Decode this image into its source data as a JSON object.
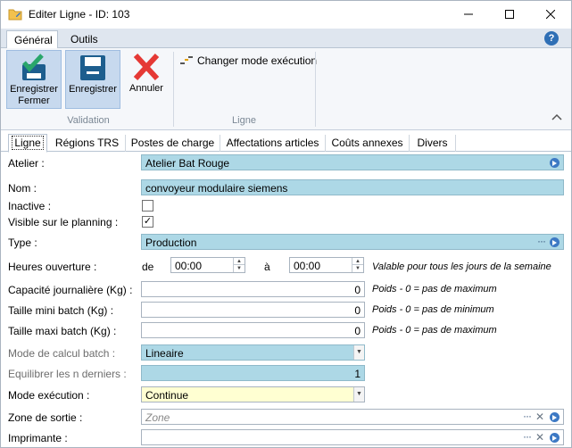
{
  "window": {
    "title": "Editer Ligne - ID: 103"
  },
  "ribbon_tabs": [
    "Général",
    "Outils"
  ],
  "ribbon": {
    "save_close": "Enregistrer\nFermer",
    "save": "Enregistrer",
    "cancel": "Annuler",
    "group_validation": "Validation",
    "change_mode": "Changer mode exécution",
    "group_ligne": "Ligne"
  },
  "tabs": [
    "Ligne",
    "Régions TRS",
    "Postes de charge",
    "Affectations articles",
    "Coûts annexes",
    "Divers"
  ],
  "form": {
    "atelier": {
      "label": "Atelier :",
      "value": "Atelier Bat Rouge"
    },
    "nom": {
      "label": "Nom :",
      "value": "convoyeur modulaire siemens"
    },
    "inactive": {
      "label": "Inactive :",
      "checked": false
    },
    "visible": {
      "label": "Visible sur le planning :",
      "checked": true,
      "mark": "✓"
    },
    "type": {
      "label": "Type :",
      "value": "Production"
    },
    "heures": {
      "label": "Heures ouverture :",
      "de_label": "de",
      "de_value": "00:00",
      "a_label": "à",
      "a_value": "00:00",
      "note": "Valable pour tous les jours de la semaine"
    },
    "capacite": {
      "label": "Capacité journalière (Kg) :",
      "value": "0",
      "note": "Poids - 0 = pas de maximum"
    },
    "taille_mini": {
      "label": "Taille mini batch (Kg) :",
      "value": "0",
      "note": "Poids - 0 = pas de minimum"
    },
    "taille_maxi": {
      "label": "Taille maxi batch (Kg) :",
      "value": "0",
      "note": "Poids - 0 = pas de maximum"
    },
    "mode_calcul": {
      "label": "Mode de calcul batch :",
      "value": "Lineaire"
    },
    "equilibrer": {
      "label": "Equilibrer les n derniers :",
      "value": "1"
    },
    "mode_execution": {
      "label": "Mode exécution :",
      "value": "Continue"
    },
    "zone_sortie": {
      "label": "Zone de sortie :",
      "placeholder": "Zone"
    },
    "imprimante": {
      "label": "Imprimante :",
      "value": ""
    }
  },
  "colors": {
    "field_blue": "#add8e6",
    "field_yellow": "#ffffd2",
    "ribbon_selected": "#c7d9ee"
  }
}
